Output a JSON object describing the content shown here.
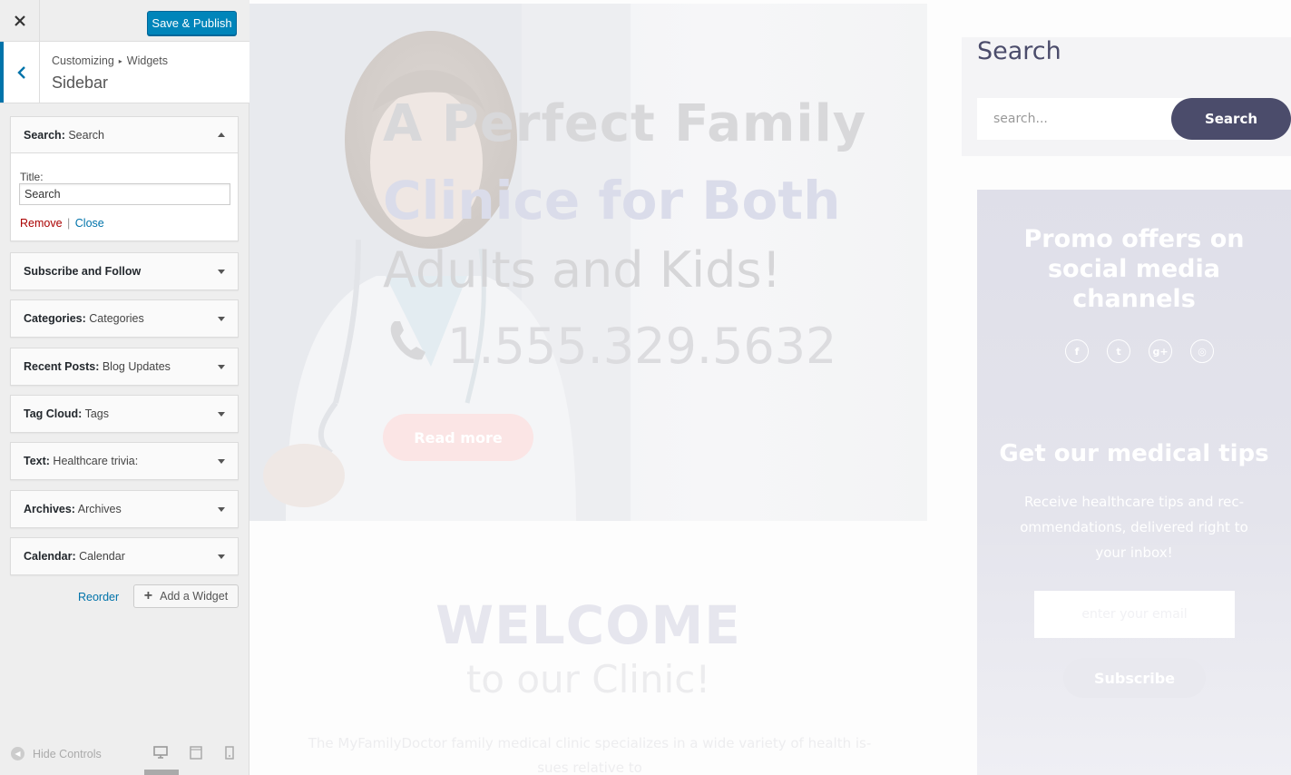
{
  "header": {
    "close_icon": "close-icon",
    "publish_label": "Save & Publish"
  },
  "section": {
    "breadcrumb_root": "Customizing",
    "breadcrumb_child": "Widgets",
    "title": "Sidebar"
  },
  "widgets": [
    {
      "type": "Search:",
      "title": "Search",
      "expanded": true
    },
    {
      "type": "Subscribe and Follow",
      "title": ""
    },
    {
      "type": "Categories:",
      "title": "Categories"
    },
    {
      "type": "Recent Posts:",
      "title": "Blog Updates"
    },
    {
      "type": "Tag Cloud:",
      "title": "Tags"
    },
    {
      "type": "Text:",
      "title": "Healthcare trivia:"
    },
    {
      "type": "Archives:",
      "title": "Archives"
    },
    {
      "type": "Calendar:",
      "title": "Calendar"
    }
  ],
  "search_form": {
    "title_label": "Title:",
    "title_value": "Search",
    "remove_label": "Remove",
    "separator": "|",
    "close_label": "Close"
  },
  "footer_actions": {
    "reorder_label": "Reorder",
    "add_widget_label": "Add a Widget"
  },
  "controls": {
    "hide_label": "Hide Controls",
    "devices": [
      "desktop",
      "tablet",
      "mobile"
    ],
    "active_device": "desktop"
  },
  "preview": {
    "hero": {
      "line1": "A Perfect Family",
      "line2": "Clinice for Both",
      "line3": "Adults and Kids!",
      "phone": "1.555.329.5632",
      "button": "Read more"
    },
    "welcome": {
      "title": "WELCOME",
      "subtitle": "to our Clinic!",
      "body_line1": "The MyFamilyDoctor family medical clinic specializes in a wide variety of health is-",
      "body_line2": "sues relative to"
    },
    "search": {
      "title": "Search",
      "placeholder": "search...",
      "button": "Search"
    },
    "promo": {
      "title_line1": "Promo offers on",
      "title_line2": "social media",
      "title_line3": "channels",
      "social": [
        {
          "icon": "facebook-icon",
          "glyph": "f"
        },
        {
          "icon": "twitter-icon",
          "glyph": "t"
        },
        {
          "icon": "google-plus-icon",
          "glyph": "g+"
        },
        {
          "icon": "instagram-icon",
          "glyph": "◎"
        }
      ],
      "tips_title": "Get our medical tips",
      "tips_line1": "Receive healthcare tips and rec-",
      "tips_line2": "ommendations, delivered right to",
      "tips_line3": "your inbox!",
      "email_placeholder": "enter your email",
      "subscribe": "Subscribe"
    }
  },
  "colors": {
    "primary": "#0085ba",
    "link": "#0073aa",
    "remove": "#a00000",
    "theme_dark": "#4b4c6b"
  }
}
